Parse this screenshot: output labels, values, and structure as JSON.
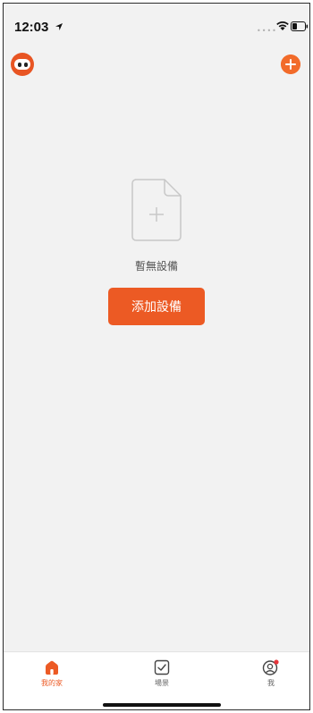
{
  "status_bar": {
    "time": "12:03",
    "icons": [
      "location-arrow-icon",
      "signal-icon",
      "wifi-icon",
      "battery-icon"
    ]
  },
  "header": {
    "avatar_icon": "robot-avatar-icon",
    "add_icon": "plus-circle-icon"
  },
  "empty_state": {
    "icon": "empty-document-plus-icon",
    "message": "暫無設備",
    "button_label": "添加設備"
  },
  "tab_bar": {
    "tabs": [
      {
        "label": "我的家",
        "icon": "home-icon",
        "active": true
      },
      {
        "label": "場景",
        "icon": "scene-checkbox-icon",
        "active": false
      },
      {
        "label": "我",
        "icon": "profile-icon",
        "active": false,
        "badge": true
      }
    ]
  },
  "colors": {
    "accent": "#ec5a24",
    "background": "#f2f2f2",
    "tab_inactive": "#666666",
    "badge": "#e8353b"
  }
}
